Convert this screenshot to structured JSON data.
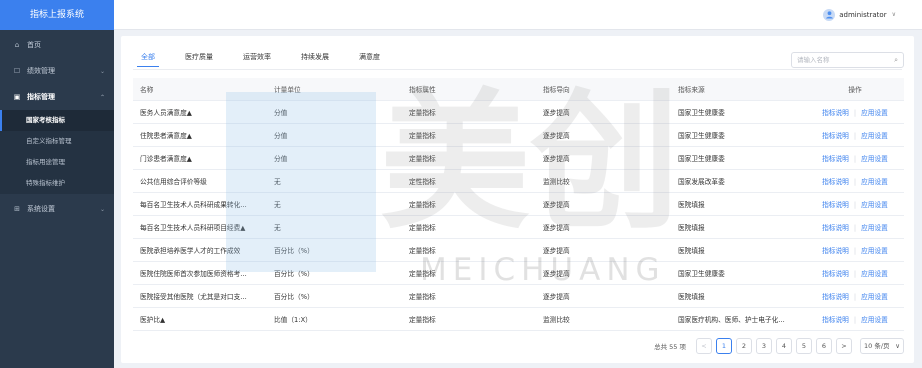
{
  "app": {
    "title": "指标上报系统"
  },
  "sidebar": {
    "items": [
      {
        "label": "首页",
        "icon": "home-icon",
        "glyph": "⌂"
      },
      {
        "label": "绩效管理",
        "icon": "chat-icon",
        "glyph": "☐",
        "chevron": "⌄"
      },
      {
        "label": "指标管理",
        "icon": "grid-icon",
        "glyph": "▣",
        "chevron": "⌃"
      }
    ],
    "sub_items": [
      {
        "label": "国家考核指标"
      },
      {
        "label": "自定义指标管理"
      },
      {
        "label": "指标用途管理"
      },
      {
        "label": "特殊指标维护"
      }
    ],
    "settings": {
      "label": "系统设置",
      "icon": "settings-grid-icon",
      "glyph": "⊞",
      "chevron": "⌄"
    }
  },
  "header": {
    "user": "administrator",
    "chevron": "∨"
  },
  "tabs": [
    "全部",
    "医疗质量",
    "运营效率",
    "持续发展",
    "满意度"
  ],
  "search": {
    "placeholder": "请输入名称",
    "icon_glyph": "⌕"
  },
  "table": {
    "columns": [
      "名称",
      "计量单位",
      "指标属性",
      "指标导向",
      "指标来源",
      "操作"
    ],
    "actions": {
      "view": "指标说明",
      "config": "应用设置"
    },
    "rows": [
      [
        "医务人员满意度▲",
        "分值",
        "定量指标",
        "逐步提高",
        "国家卫生健康委"
      ],
      [
        "住院患者满意度▲",
        "分值",
        "定量指标",
        "逐步提高",
        "国家卫生健康委"
      ],
      [
        "门诊患者满意度▲",
        "分值",
        "定量指标",
        "逐步提高",
        "国家卫生健康委"
      ],
      [
        "公共信用综合评价等级",
        "无",
        "定性指标",
        "监测比较",
        "国家发展改革委"
      ],
      [
        "每百名卫生技术人员科研成果转化...",
        "无",
        "定量指标",
        "逐步提高",
        "医院填报"
      ],
      [
        "每百名卫生技术人员科研项目经费▲",
        "无",
        "定量指标",
        "逐步提高",
        "医院填报"
      ],
      [
        "医院承担培养医学人才的工作成效",
        "百分比（%）",
        "定量指标",
        "逐步提高",
        "医院填报"
      ],
      [
        "医院住院医师首次参加医师资格考...",
        "百分比（%）",
        "定量指标",
        "逐步提高",
        "国家卫生健康委"
      ],
      [
        "医院接受其他医院（尤其是对口支...",
        "百分比（%）",
        "定量指标",
        "逐步提高",
        "医院填报"
      ],
      [
        "医护比▲",
        "比值（1:X）",
        "定量指标",
        "监测比较",
        "国家医疗机构、医师、护士电子化..."
      ]
    ]
  },
  "pagination": {
    "total": "总共 55 项",
    "prev": "<",
    "next": ">",
    "pages": [
      "1",
      "2",
      "3",
      "4",
      "5",
      "6"
    ],
    "current": "1",
    "page_size": "10 条/页",
    "page_size_chevron": "∨"
  },
  "watermark": {
    "text": "MEICHUANG",
    "chars": "美创"
  },
  "colors": {
    "accent": "#3b80ee",
    "sidebar": "#2b3a4c"
  }
}
